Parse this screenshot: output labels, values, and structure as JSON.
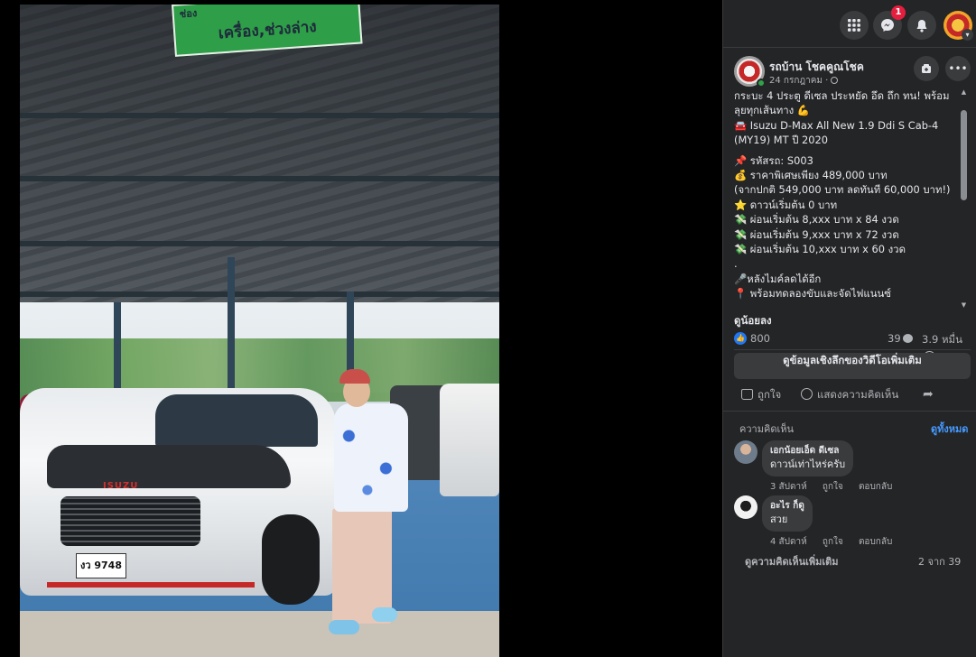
{
  "video": {
    "sign_top": "ช่อง",
    "sign_text": "เครื่อง,ช่วงล่าง",
    "car_logo": "ISUZU",
    "plate": "งว 9748"
  },
  "topbar": {
    "messenger_badge": "1",
    "icons": [
      "apps-grid-icon",
      "messenger-icon",
      "notifications-bell-icon",
      "account-avatar"
    ]
  },
  "post": {
    "author": "รถบ้าน โชคคูณโชค",
    "date": "24 กรกฎาคม ·",
    "body_lines": [
      "กระบะ 4 ประตู ดีเซล ประหยัด อึด ถึก ทน! พร้อมลุยทุกเส้นทาง 💪",
      "🚘 Isuzu D-Max All New 1.9 Ddi S Cab-4 (MY19) MT ปี 2020",
      "",
      "📌 รหัสรถ: S003",
      "💰 ราคาพิเศษเพียง 489,000 บาท",
      "(จากปกติ 549,000 บาท ลดทันที 60,000 บาท!)",
      "⭐ ดาวน์เริ่มต้น 0 บาท",
      "💸 ผ่อนเริ่มต้น 8,xxx บาท x 84 งวด",
      "💸 ผ่อนเริ่มต้น 9,xxx บาท x 72 งวด",
      "💸 ผ่อนเริ่มต้น 10,xxx บาท x 60 งวด",
      ".",
      "🎤หลังไมค์ลดได้อีก",
      "📍 พร้อมทดลองขับและจัดไฟแนนซ์",
      "."
    ],
    "see_less": "ดูน้อยลง",
    "like_count": "800",
    "comment_count": "39",
    "view_count": "3.9 หมื่น",
    "insights_button": "ดูข้อมูลเชิงลึกของวิดีโอเพิ่มเติม",
    "actions": {
      "like": "ถูกใจ",
      "comment": "แสดงความคิดเห็น"
    }
  },
  "comments": {
    "header": "ความคิดเห็น",
    "see_all": "ดูทั้งหมด",
    "items": [
      {
        "name": "เอกน้อยเอ็ด ดีเซล",
        "text": "ดาวน์เท่าไหร่ครับ",
        "time": "3 สัปดาห์",
        "like": "ถูกใจ",
        "reply": "ตอบกลับ"
      },
      {
        "name": "อะไร ก็ดู",
        "text": "สวย",
        "time": "4 สัปดาห์",
        "like": "ถูกใจ",
        "reply": "ตอบกลับ"
      }
    ],
    "more": "ดูความคิดเห็นเพิ่มเติม",
    "pager": "2 จาก 39"
  },
  "colors": {
    "panel_bg": "#242526",
    "button_bg": "#3a3b3c",
    "link_blue": "#4599ff",
    "like_blue": "#2078f4",
    "badge_red": "#e41e3f"
  }
}
